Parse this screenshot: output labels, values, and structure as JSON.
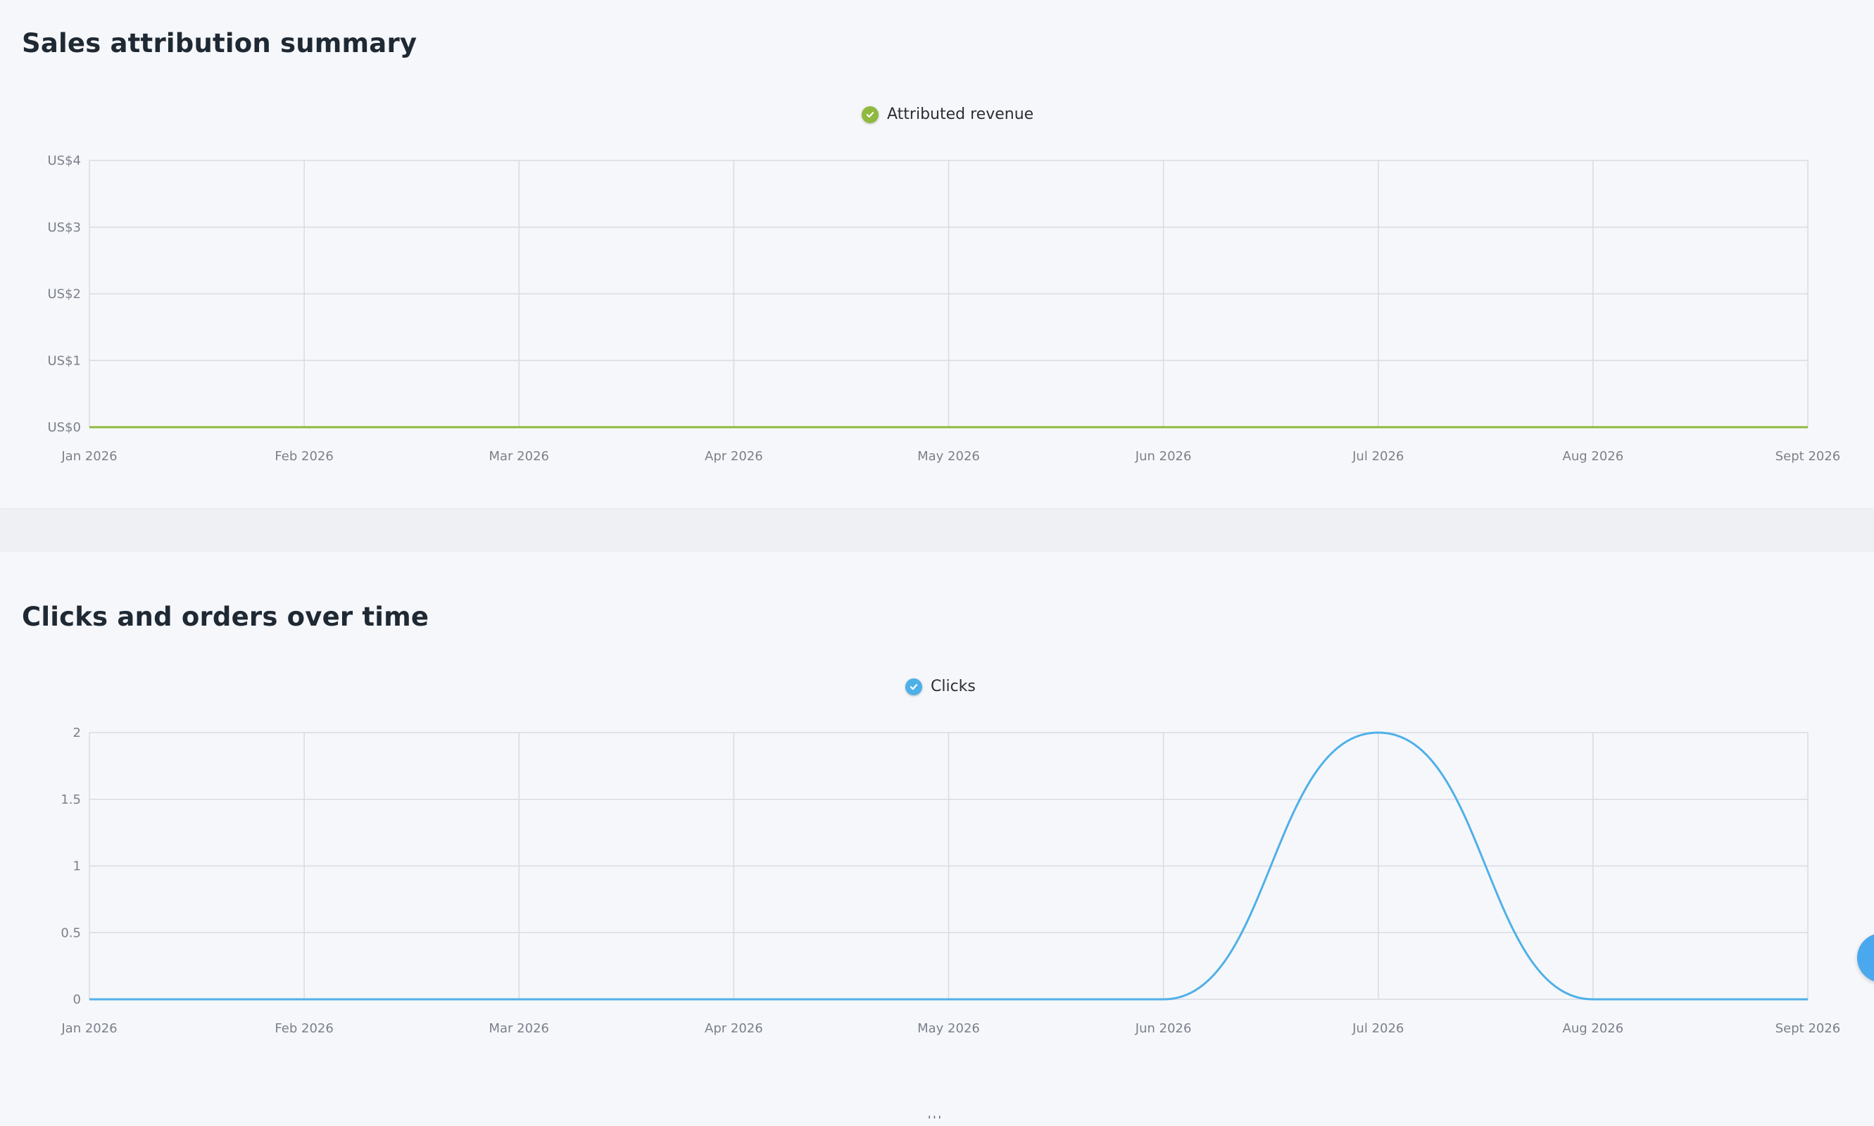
{
  "colors": {
    "revenue": "#8fb93f",
    "clicks": "#4fb0e8",
    "grid": "#d8dbe1",
    "axis_text": "#7b8089"
  },
  "sections": {
    "sales": {
      "title": "Sales attribution summary",
      "legend_label": "Attributed revenue",
      "legend_icon": "check-circle-icon"
    },
    "clicks": {
      "title": "Clicks and orders over time",
      "legend_label": "Clicks",
      "legend_icon": "check-circle-icon"
    }
  },
  "chart_data": [
    {
      "type": "line",
      "title": "Sales attribution summary",
      "x": [
        "Jan 2026",
        "Feb 2026",
        "Mar 2026",
        "Apr 2026",
        "May 2026",
        "Jun 2026",
        "Jul 2026",
        "Aug 2026",
        "Sept 2026"
      ],
      "series": [
        {
          "name": "Attributed revenue",
          "values": [
            0,
            0,
            0,
            0,
            0,
            0,
            0,
            0,
            0
          ]
        }
      ],
      "y_ticks": [
        "US$0",
        "US$1",
        "US$2",
        "US$3",
        "US$4"
      ],
      "y_tick_values": [
        0,
        1,
        2,
        3,
        4
      ],
      "ylim": [
        0,
        4
      ],
      "grid": true,
      "legend": "top-center"
    },
    {
      "type": "line",
      "title": "Clicks and orders over time",
      "x": [
        "Jan 2026",
        "Feb 2026",
        "Mar 2026",
        "Apr 2026",
        "May 2026",
        "Jun 2026",
        "Jul 2026",
        "Aug 2026",
        "Sept 2026"
      ],
      "series": [
        {
          "name": "Clicks",
          "values": [
            0,
            0,
            0,
            0,
            0,
            0,
            2,
            0,
            0
          ]
        }
      ],
      "y_ticks": [
        "0",
        "0.5",
        "1",
        "1.5",
        "2"
      ],
      "y_tick_values": [
        0,
        0.5,
        1,
        1.5,
        2
      ],
      "ylim": [
        0,
        2
      ],
      "grid": true,
      "legend": "top-center"
    }
  ]
}
